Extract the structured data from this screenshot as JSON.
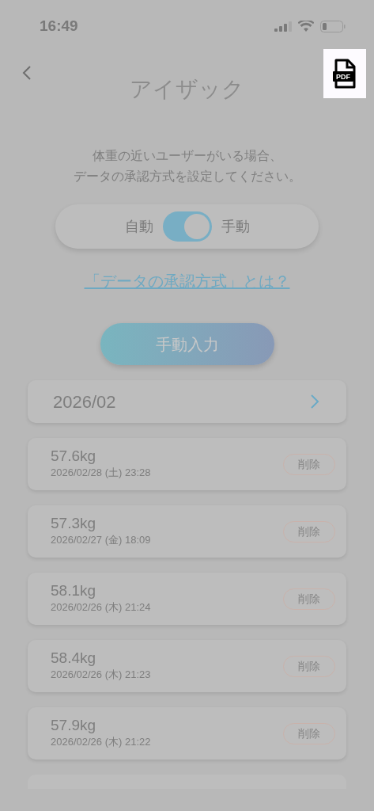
{
  "status_bar": {
    "time": "16:49"
  },
  "header": {
    "title": "アイザック",
    "pdf_label": "PDF",
    "pdf_highlighted": true
  },
  "description": [
    "体重の近いユーザーがいる場合、",
    "データの承認方式を設定してください。"
  ],
  "approval_toggle": {
    "left_label": "自動",
    "right_label": "手動",
    "on": true
  },
  "help_link": "「データの承認方式」とは？",
  "manual_entry_button": "手動入力",
  "month": {
    "label": "2026/02"
  },
  "records": [
    {
      "weight": "57.6kg",
      "datetime": "2026/02/28 (土) 23:28",
      "delete_label": "削除"
    },
    {
      "weight": "57.3kg",
      "datetime": "2026/02/27 (金) 18:09",
      "delete_label": "削除"
    },
    {
      "weight": "58.1kg",
      "datetime": "2026/02/26 (木) 21:24",
      "delete_label": "削除"
    },
    {
      "weight": "58.4kg",
      "datetime": "2026/02/26 (木) 21:23",
      "delete_label": "削除"
    },
    {
      "weight": "57.9kg",
      "datetime": "2026/02/26 (木) 21:22",
      "delete_label": "削除"
    }
  ]
}
